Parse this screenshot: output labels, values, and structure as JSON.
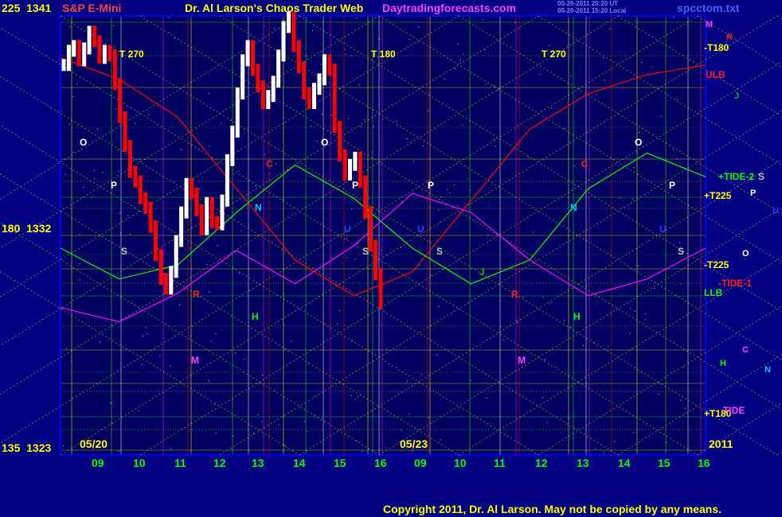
{
  "header": {
    "symbol": "S&P E-Mini",
    "title": "Dr. Al Larson's Chaos Trader Web",
    "site": "Daytradingforecasts.com",
    "stamp1": "05-20-2011 20:20 UT",
    "stamp2": "05-20-2011 15:20 Local",
    "file": "spcctom.txt"
  },
  "footer": {
    "copyright": "Copyright 2011, Dr. Al Larson. May not be copied by any means."
  },
  "colors": {
    "background": "#000080",
    "grid_yellow": "#ffff00",
    "grid_green": "#00ff00",
    "grid_white": "#ffffff",
    "price_up": "#ffffff",
    "price_down": "#ff0000",
    "magenta": "#ff00ff",
    "axis_blue": "#0000ff"
  },
  "chart_data": {
    "type": "line",
    "title": "S&P E-Mini",
    "y_labels_left": [
      {
        "angle": "225",
        "price": "1341"
      },
      {
        "angle": "180",
        "price": "1332"
      },
      {
        "angle": "135",
        "price": "1323"
      }
    ],
    "ylim": [
      1323,
      1341
    ],
    "x_date_labels": [
      "05/20",
      "05/23"
    ],
    "year_label": "2011",
    "x_ticks": [
      "09",
      "10",
      "11",
      "12",
      "13",
      "14",
      "15",
      "16",
      "09",
      "10",
      "11",
      "12",
      "13",
      "14",
      "15",
      "16"
    ],
    "harmonic_labels": [
      "T 270",
      "T 180",
      "T 270"
    ],
    "right_labels": [
      "M",
      "R",
      "-T180",
      "ULB",
      "J",
      "+TIDE-2",
      "S",
      "+T225",
      "P",
      "U",
      "-T225",
      "O",
      "-TIDE-1",
      "LLB",
      "C",
      "H",
      "N",
      "+T180",
      "TIDE"
    ],
    "planet_labels": [
      "O",
      "P",
      "S",
      "N",
      "C",
      "R",
      "M",
      "H",
      "U",
      "J"
    ],
    "series": [
      {
        "name": "price",
        "y": [
          1339.2,
          1339.8,
          1340.0,
          1339.4,
          1339.9,
          1340.6,
          1340.2,
          1339.5,
          1339.8,
          1339.6,
          1338.4,
          1337.0,
          1335.8,
          1334.7,
          1334.3,
          1333.6,
          1333.2,
          1332.4,
          1331.2,
          1330.2,
          1329.8,
          1330.5,
          1331.8,
          1333.0,
          1334.2,
          1333.8,
          1333.1,
          1332.3,
          1333.4,
          1332.6,
          1332.5,
          1333.5,
          1335.2,
          1336.4,
          1338.0,
          1339.4,
          1340.0,
          1339.0,
          1338.3,
          1337.6,
          1337.9,
          1338.5,
          1339.6,
          1340.8,
          1341.2,
          1340.0,
          1339.1,
          1338.0,
          1337.6,
          1338.2,
          1338.6,
          1339.4,
          1339.0,
          1336.6,
          1335.4,
          1334.6,
          1335.0,
          1335.3,
          1334.3,
          1333.0,
          1331.6,
          1330.4,
          1329.2
        ]
      },
      {
        "name": "Tide-1",
        "y": [
          1339.5,
          1338.6,
          1337.0,
          1334.0,
          1331.0,
          1329.5,
          1330.5,
          1333.5,
          1336.5,
          1338.0,
          1338.8,
          1339.2
        ]
      },
      {
        "name": "Tide-2",
        "y": [
          1331.5,
          1330.2,
          1330.8,
          1333.0,
          1335.0,
          1333.6,
          1331.5,
          1330.0,
          1331.0,
          1334.0,
          1335.5,
          1334.5
        ]
      },
      {
        "name": "TIDE",
        "y": [
          1329.0,
          1328.4,
          1329.6,
          1331.4,
          1330.0,
          1331.6,
          1333.8,
          1333.0,
          1331.0,
          1329.5,
          1330.2,
          1331.5
        ]
      }
    ]
  }
}
